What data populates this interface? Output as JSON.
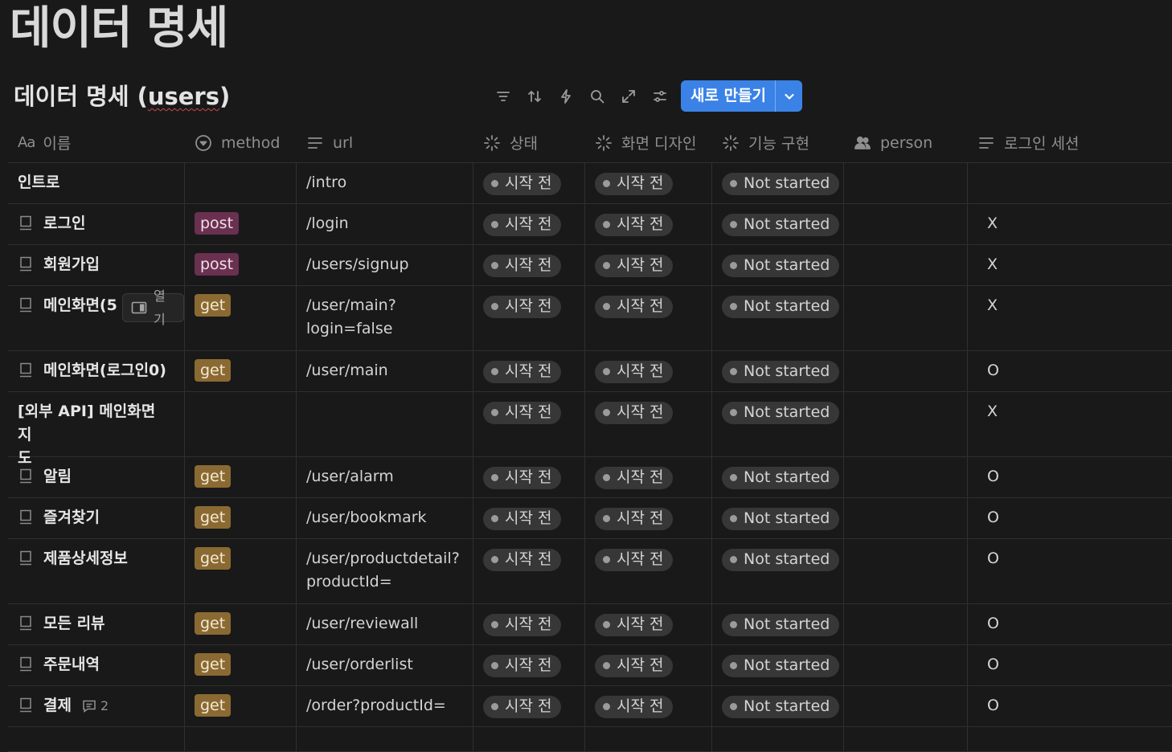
{
  "page": {
    "title": "데이터 명세"
  },
  "database": {
    "title_prefix": "데이터 명세 (",
    "title_word": "users",
    "title_suffix": ")",
    "new_button": "새로 만들기"
  },
  "toolbar": {
    "icons": [
      "filter-icon",
      "sort-icon",
      "automation-icon",
      "search-icon",
      "expand-icon",
      "settings-icon"
    ]
  },
  "columns": {
    "name_prefix": "Aa",
    "name": "이름",
    "method": "method",
    "url": "url",
    "status": "상태",
    "screen_design": "화면 디자인",
    "feature": "기능 구현",
    "person": "person",
    "login_session": "로그인 세션"
  },
  "open_chip": "열기",
  "rows": [
    {
      "name": "인트로",
      "doc": false,
      "method": "",
      "url": "/intro",
      "status": "시작 전",
      "design": "시작 전",
      "feature": "Not started",
      "session": ""
    },
    {
      "name": "로그인",
      "doc": true,
      "method": "post",
      "url": "/login",
      "status": "시작 전",
      "design": "시작 전",
      "feature": "Not started",
      "session": "X"
    },
    {
      "name": "회원가입",
      "doc": true,
      "method": "post",
      "url": "/users/signup",
      "status": "시작 전",
      "design": "시작 전",
      "feature": "Not started",
      "session": "X"
    },
    {
      "name": "메인화면(5",
      "doc": true,
      "method": "get",
      "url": "/user/main?login=false",
      "url_line1": "/user/main?",
      "url_line2": "login=false",
      "status": "시작 전",
      "design": "시작 전",
      "feature": "Not started",
      "session": "X"
    },
    {
      "name": "메인화면(로그인0)",
      "doc": true,
      "method": "get",
      "url": "/user/main",
      "status": "시작 전",
      "design": "시작 전",
      "feature": "Not started",
      "session": "O"
    },
    {
      "name": "[외부 API] 메인화면 지도",
      "name_line1": "[외부 API] 메인화면 지",
      "name_line2": "도",
      "doc": false,
      "method": "",
      "url": "",
      "status": "시작 전",
      "design": "시작 전",
      "feature": "Not started",
      "session": "X"
    },
    {
      "name": "알림",
      "doc": true,
      "method": "get",
      "url": "/user/alarm",
      "status": "시작 전",
      "design": "시작 전",
      "feature": "Not started",
      "session": "O"
    },
    {
      "name": "즐겨찾기",
      "doc": true,
      "method": "get",
      "url": "/user/bookmark",
      "status": "시작 전",
      "design": "시작 전",
      "feature": "Not started",
      "session": "O"
    },
    {
      "name": "제품상세정보",
      "doc": true,
      "method": "get",
      "url": "/user/productdetail?productId=",
      "url_line1": "/user/productdetail?",
      "url_line2": "productId=",
      "status": "시작 전",
      "design": "시작 전",
      "feature": "Not started",
      "session": "O"
    },
    {
      "name": "모든 리뷰",
      "doc": true,
      "method": "get",
      "url": "/user/reviewall",
      "status": "시작 전",
      "design": "시작 전",
      "feature": "Not started",
      "session": "O"
    },
    {
      "name": "주문내역",
      "doc": true,
      "method": "get",
      "url": "/user/orderlist",
      "status": "시작 전",
      "design": "시작 전",
      "feature": "Not started",
      "session": "O"
    },
    {
      "name": "결제",
      "doc": true,
      "method": "get",
      "url": "/order?productId=",
      "status": "시작 전",
      "design": "시작 전",
      "feature": "Not started",
      "session": "O",
      "comments": "2"
    }
  ],
  "colors": {
    "background": "#191919",
    "accent": "#3a82e6",
    "post_tag": "#6a3050",
    "get_tag": "#8a6a32",
    "pill": "#373737"
  }
}
